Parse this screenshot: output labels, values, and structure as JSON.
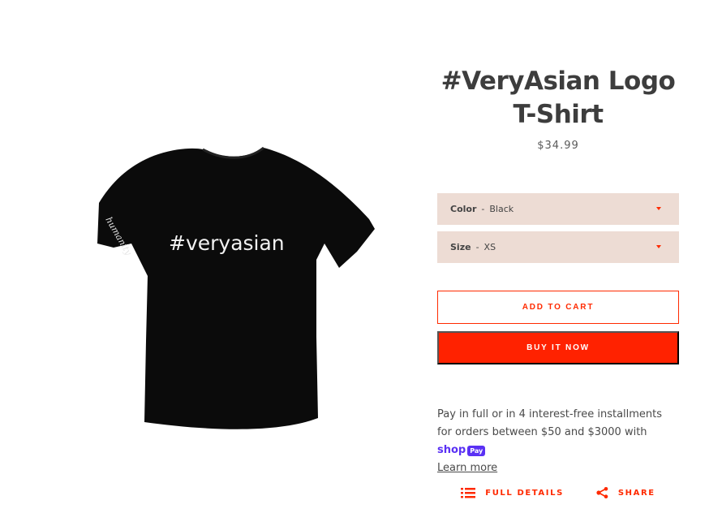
{
  "product": {
    "title": "#VeryAsian Logo T-Shirt",
    "price": "$34.99",
    "image": {
      "shirt_print": "#veryasian",
      "sleeve_print": "humanity"
    }
  },
  "options": {
    "color": {
      "label": "Color",
      "value": "Black"
    },
    "size": {
      "label": "Size",
      "value": "XS"
    }
  },
  "buttons": {
    "add_to_cart": "ADD TO CART",
    "buy_now": "BUY IT NOW"
  },
  "installments": {
    "text": "Pay in full or in 4 interest-free installments for orders between $50 and $3000 with",
    "brand": "shop",
    "brand_badge": "Pay",
    "learn_more": "Learn more"
  },
  "actions": {
    "full_details": "FULL DETAILS",
    "share": "SHARE"
  },
  "colors": {
    "accent": "#ff2a00",
    "select_bg": "#eddcd4",
    "shop_pay": "#5a31f4"
  }
}
